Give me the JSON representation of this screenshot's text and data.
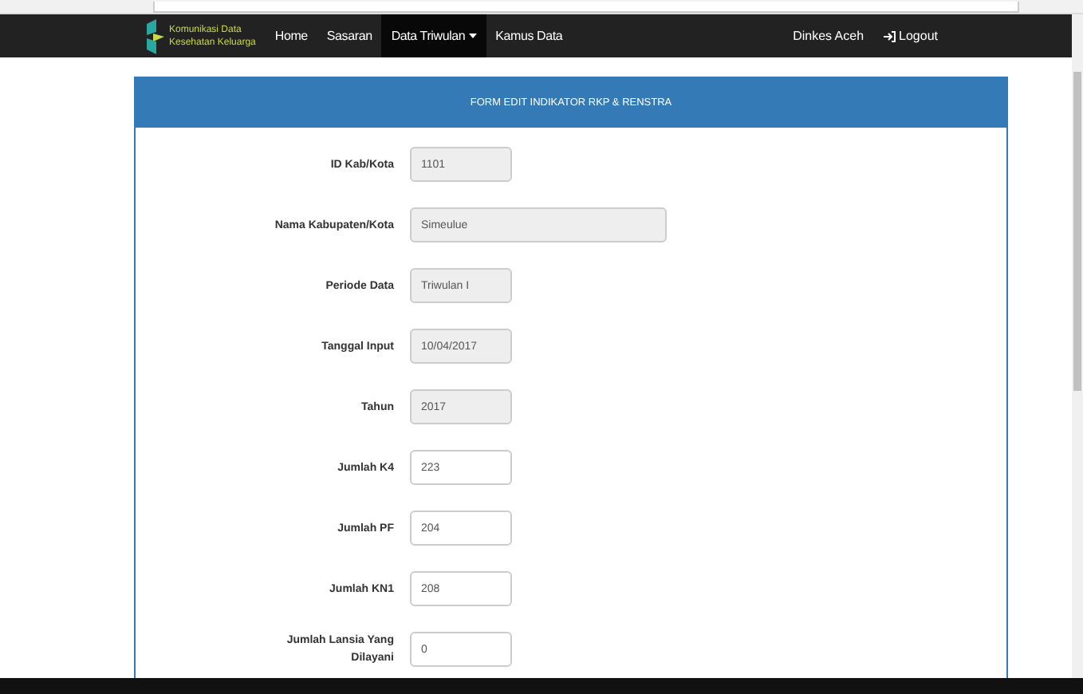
{
  "navbar": {
    "logo_lines": [
      "Komunikasi Data",
      "Kesehatan Keluarga"
    ],
    "items": [
      {
        "label": "Home",
        "selected": false,
        "dropdown": false
      },
      {
        "label": "Sasaran",
        "selected": false,
        "dropdown": false
      },
      {
        "label": "Data Triwulan",
        "selected": true,
        "dropdown": true
      },
      {
        "label": "Kamus Data",
        "selected": false,
        "dropdown": false
      }
    ],
    "user": "Dinkes Aceh",
    "logout": "Logout"
  },
  "form": {
    "title": "FORM EDIT INDIKATOR RKP & RENSTRA",
    "fields": [
      {
        "label": "ID Kab/Kota",
        "value": "1101",
        "disabled": true,
        "kind": "short"
      },
      {
        "label": "Nama Kabupaten/Kota",
        "value": "Simeulue",
        "disabled": true,
        "kind": "wide"
      },
      {
        "label": "Periode Data",
        "value": "Triwulan I",
        "disabled": true,
        "kind": "short"
      },
      {
        "label": "Tanggal Input",
        "value": "10/04/2017",
        "disabled": true,
        "kind": "short"
      },
      {
        "label": "Tahun",
        "value": "2017",
        "disabled": true,
        "kind": "short"
      },
      {
        "label": "Jumlah K4",
        "value": "223",
        "disabled": false,
        "kind": "short"
      },
      {
        "label": "Jumlah PF",
        "value": "204",
        "disabled": false,
        "kind": "short"
      },
      {
        "label": "Jumlah KN1",
        "value": "208",
        "disabled": false,
        "kind": "short"
      },
      {
        "label": "Jumlah Lansia Yang Dilayani",
        "value": "0",
        "disabled": false,
        "kind": "short"
      }
    ]
  }
}
